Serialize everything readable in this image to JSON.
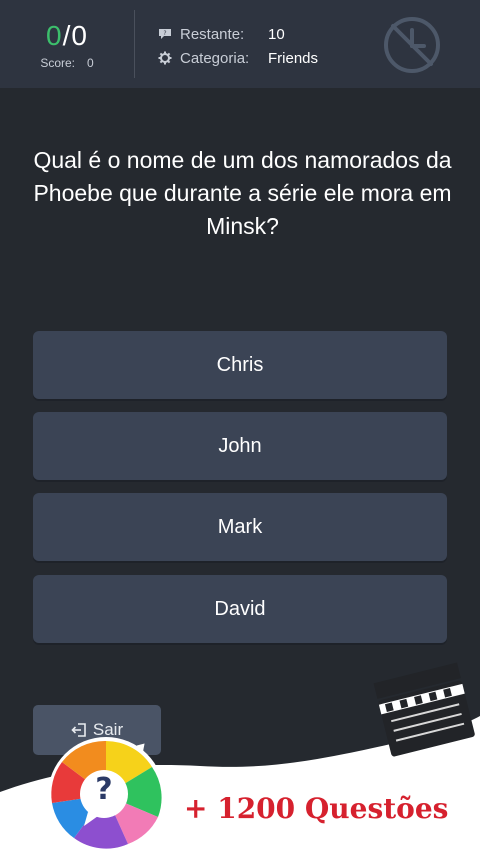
{
  "score": {
    "correct": "0",
    "separator": "/",
    "total": "0",
    "score_label": "Score:",
    "score_value": "0"
  },
  "info": {
    "remaining_label": "Restante:",
    "remaining_value": "10",
    "category_label": "Categoria:",
    "category_value": "Friends"
  },
  "icons": {
    "timer": "timer-off-icon",
    "remaining": "speech-bubble-icon",
    "category": "gear-icon",
    "exit": "exit-icon"
  },
  "question": "Qual é o nome de um dos namorados da Phoebe que durante a série ele mora em Minsk?",
  "answers": [
    "Chris",
    "John",
    "Mark",
    "David"
  ],
  "exit_label": "Sair",
  "promo": {
    "text": "+ 1200 Questões",
    "badge_glyph": "?"
  },
  "colors": {
    "correct": "#3cbf6c",
    "answer_bg": "#3b4455",
    "promo_red": "#d6212e",
    "background": "#25292f",
    "header": "#2e3440"
  }
}
